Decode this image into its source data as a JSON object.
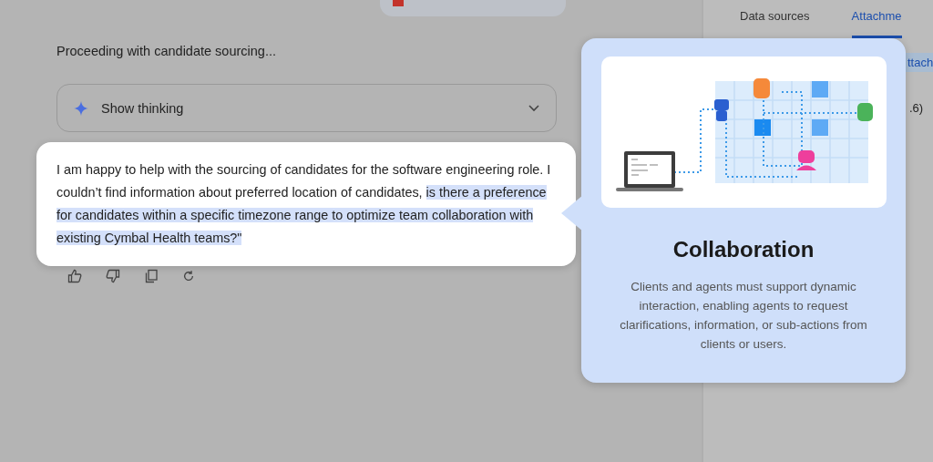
{
  "status_line": "Proceeding with candidate sourcing...",
  "thinking": {
    "label": "Show thinking",
    "expanded": false
  },
  "message": {
    "text": "I am happy to help with the sourcing of candidates for the software engineering role. I couldn’t find information about preferred location of candidates, ",
    "highlighted": "is there a preference for candidates within a specific timezone range to optimize team collaboration with existing Cymbal Health teams?\""
  },
  "actions": [
    {
      "kind": "like"
    },
    {
      "kind": "dislike"
    },
    {
      "kind": "copy"
    },
    {
      "kind": "retry"
    }
  ],
  "side_panel": {
    "tabs": [
      {
        "label": "Data sources",
        "selected": false
      },
      {
        "label": "Attachme",
        "selected": true
      }
    ],
    "chip": "ttach",
    "count": ".6)"
  },
  "overlay": {
    "title": "Collaboration",
    "description": "Clients and agents must support dynamic interaction, enabling agents to request clarifications, information, or sub-actions from clients or users."
  }
}
